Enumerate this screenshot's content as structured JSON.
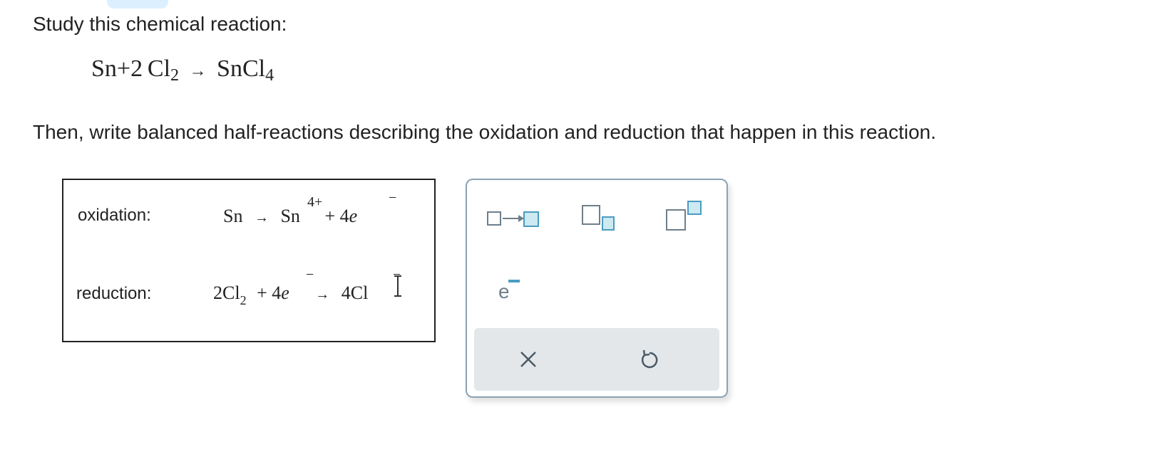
{
  "prompt": "Study this chemical reaction:",
  "equation": {
    "reactant1": "Sn",
    "plus": "+",
    "coeff": "2",
    "reactant2": "Cl",
    "reactant2_sub": "2",
    "arrow": "→",
    "product": "SnCl",
    "product_sub": "4"
  },
  "instruction": "Then, write balanced half-reactions describing the oxidation and reduction that happen in this reaction.",
  "answers": {
    "oxidation_label": "oxidation:",
    "oxidation": {
      "left": "Sn",
      "arrow": "→",
      "product": "Sn",
      "charge": "4+",
      "plus": "+ 4",
      "electron": "e",
      "electron_charge": "−"
    },
    "reduction_label": "reduction:",
    "reduction": {
      "left": "2Cl",
      "left_sub": "2",
      "plus": "+ 4",
      "electron": "e",
      "electron_charge": "−",
      "arrow": "→",
      "product": "4Cl",
      "product_charge": "−"
    }
  },
  "palette": {
    "tools": [
      "reaction-arrow-icon",
      "subscript-icon",
      "superscript-icon",
      "electron-icon"
    ],
    "electron_glyph": "e",
    "clear_icon": "×",
    "undo_icon": "undo-icon",
    "colors": {
      "accent": "#4a9cc0",
      "box_fill": "#cde9f2",
      "border": "#8ba3b3",
      "icon_gray": "#6e7f8a"
    }
  }
}
